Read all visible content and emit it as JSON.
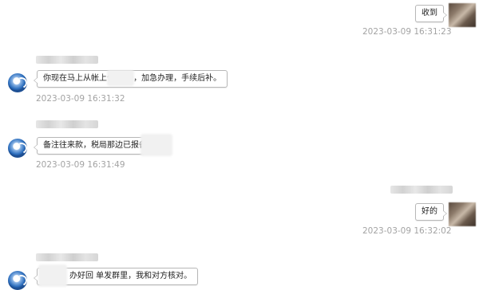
{
  "messages": [
    {
      "side": "right",
      "text": "收到",
      "time": "2023-03-09 16:31:23"
    },
    {
      "side": "left",
      "text": "你现在马上从帐上付 过去，加急办理，手续后补。",
      "time": "2023-03-09 16:31:32"
    },
    {
      "side": "left",
      "text": "备注往来款，税局那边已报备",
      "time": "2023-03-09 16:31:49"
    },
    {
      "side": "right",
      "text": "好的",
      "time": "2023-03-09 16:32:02"
    },
    {
      "side": "left",
      "text": "办好回 单发群里，我和对方核对。",
      "time": ""
    }
  ],
  "icons": {
    "left_avatar": "chat-bubble-icon",
    "right_avatar": "user-photo"
  }
}
